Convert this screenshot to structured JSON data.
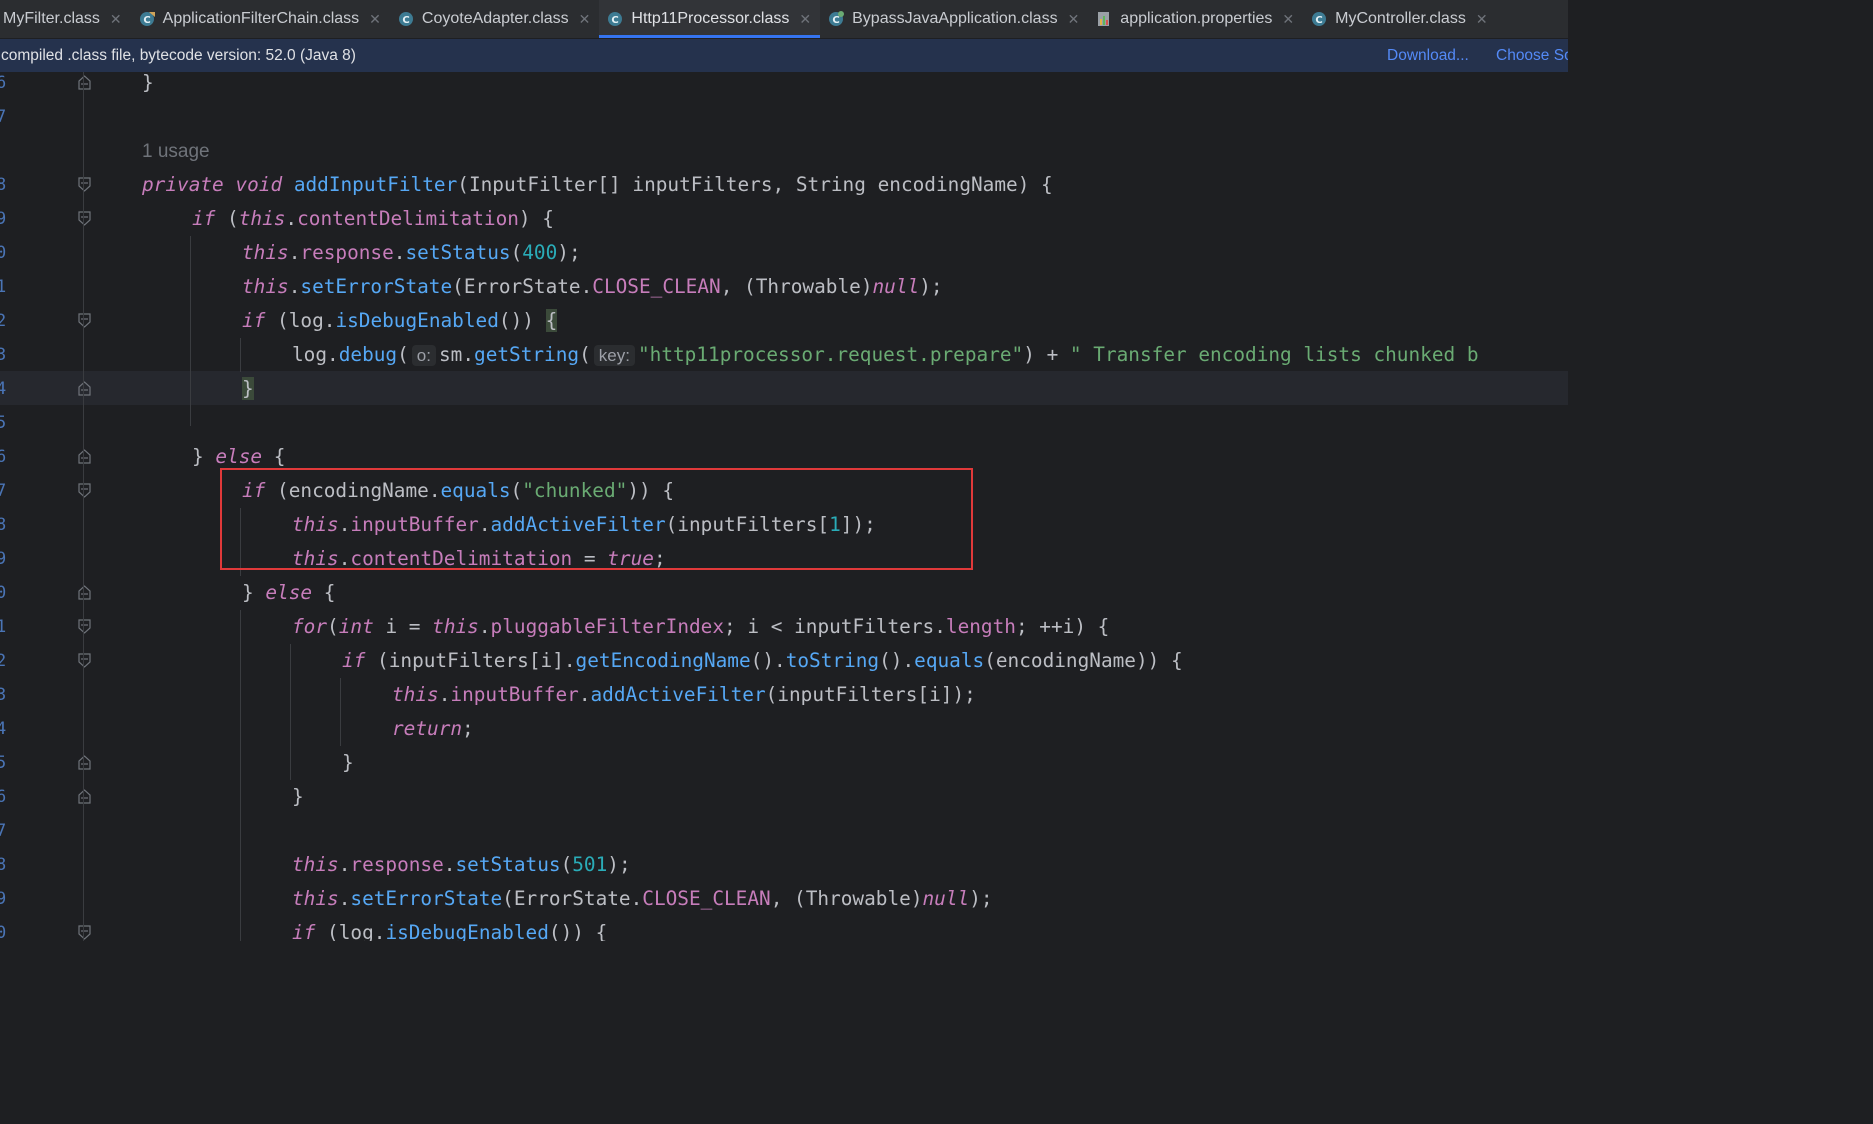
{
  "tabs": [
    {
      "label": "MyFilter.class",
      "icon": "class-icon",
      "active": false
    },
    {
      "label": "ApplicationFilterChain.class",
      "icon": "class-icon",
      "active": false
    },
    {
      "label": "CoyoteAdapter.class",
      "icon": "class-icon",
      "active": false
    },
    {
      "label": "Http11Processor.class",
      "icon": "class-icon",
      "active": true
    },
    {
      "label": "BypassJavaApplication.class",
      "icon": "spring-class-icon",
      "active": false
    },
    {
      "label": "application.properties",
      "icon": "properties-file-icon",
      "active": false
    },
    {
      "label": "MyController.class",
      "icon": "class-icon",
      "active": false
    }
  ],
  "banner": {
    "text": "compiled .class file, bytecode version: 52.0 (Java 8)",
    "download_label": "Download...",
    "choose_label": "Choose So"
  },
  "line_numbers": [
    "6",
    "7",
    "",
    "8",
    "9",
    "0",
    "1",
    "2",
    "3",
    "4",
    "5",
    "6",
    "7",
    "8",
    "9",
    "0",
    "1",
    "2",
    "3",
    "4",
    "5",
    "6",
    "7",
    "8",
    "9",
    "0"
  ],
  "code": {
    "usage": "1 usage",
    "inlay_o": "o:",
    "inlay_key": "key:",
    "lines": [
      "}",
      "",
      "1 usage",
      "private void addInputFilter(InputFilter[] inputFilters, String encodingName) {",
      "if (this.contentDelimitation) {",
      "this.response.setStatus(400);",
      "this.setErrorState(ErrorState.CLOSE_CLEAN, (Throwable)null);",
      "if (log.isDebugEnabled()) {",
      "log.debug( o: sm.getString( key: \"http11processor.request.prepare\") + \" Transfer encoding lists chunked b",
      "}",
      "",
      "} else {",
      "if (encodingName.equals(\"chunked\")) {",
      "this.inputBuffer.addActiveFilter(inputFilters[1]);",
      "this.contentDelimitation = true;",
      "} else {",
      "for(int i = this.pluggableFilterIndex; i < inputFilters.length; ++i) {",
      "if (inputFilters[i].getEncodingName().toString().equals(encodingName)) {",
      "this.inputBuffer.addActiveFilter(inputFilters[i]);",
      "return;",
      "}",
      "}",
      "",
      "this.response.setStatus(501);",
      "this.setErrorState(ErrorState.CLOSE_CLEAN, (Throwable)null);",
      "if (log.isDebugEnabled()) {"
    ]
  },
  "colors": {
    "editor_bg": "#1e1f22",
    "tabbar_bg": "#2b2d30",
    "banner_bg": "#25324d",
    "accent": "#3574f0",
    "keyword": "#cf8e6d",
    "method": "#56a8f5",
    "field": "#c77dbb",
    "string": "#6aab73",
    "number": "#2aacb8",
    "highlight_box": "#e0393a"
  }
}
